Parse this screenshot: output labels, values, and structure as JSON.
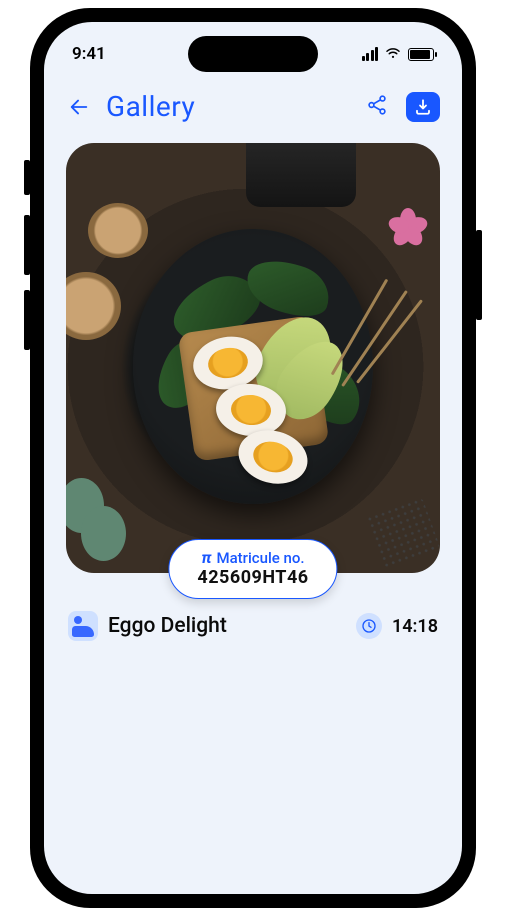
{
  "status": {
    "time": "9:41"
  },
  "nav": {
    "title": "Gallery"
  },
  "chip": {
    "label": "Matricule no.",
    "value": "425609HT46"
  },
  "detail": {
    "dish_name": "Eggo Delight",
    "time": "14:18"
  }
}
